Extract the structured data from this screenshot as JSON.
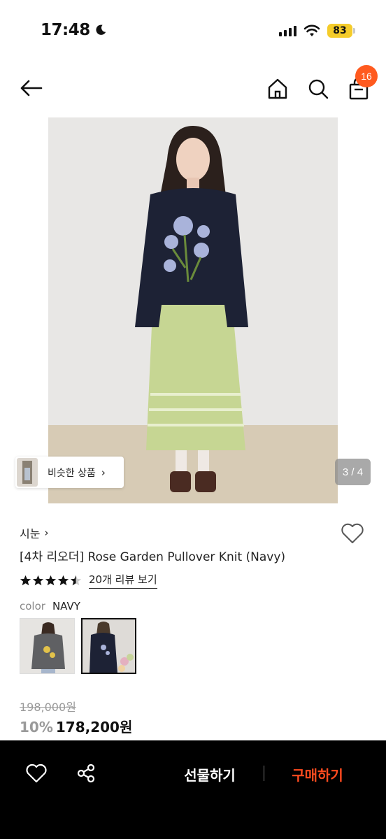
{
  "status_bar": {
    "time": "17:48",
    "battery": "83"
  },
  "header": {
    "cart_count": "16"
  },
  "gallery": {
    "similar_label": "비슷한 상품",
    "page_indicator": "3 / 4"
  },
  "product": {
    "brand": "시눈",
    "title": "[4차 리오더] Rose Garden Pullover Knit (Navy)",
    "rating": 4.5,
    "review_link": "20개 리뷰 보기",
    "color_label": "color",
    "color_value": "NAVY",
    "price_original": "198,000원",
    "discount": "10%",
    "price": "178,200원"
  },
  "bottom_bar": {
    "gift_label": "선물하기",
    "buy_label": "구매하기"
  },
  "colors": {
    "accent": "#ff4b1f",
    "badge": "#ff5a1f",
    "battery": "#f5cc2a"
  }
}
